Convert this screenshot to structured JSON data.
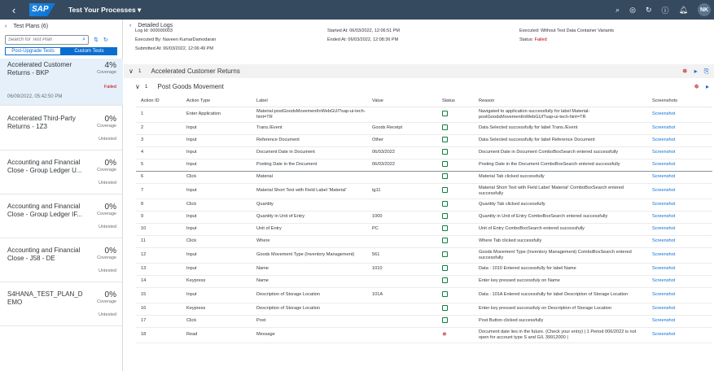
{
  "shell": {
    "app_title": "Test Your Processes ▾",
    "user_initials": "NK",
    "logo_text": "SAP"
  },
  "left": {
    "header": "Test Plans (6)",
    "search_placeholder": "Search for Test Plan",
    "seg_post_upgrade": "Post-Upgrade Tests",
    "seg_custom": "Custom Tests",
    "plans": [
      {
        "name": "Accelerated Customer Returns - BKP",
        "pct": "4%",
        "coverage": "Coverage",
        "status": "Failed",
        "date": "06/09/2022, 05:42:50 PM"
      },
      {
        "name": "Accelerated Third-Party Returns - 1Z3",
        "pct": "0%",
        "coverage": "Coverage",
        "status": "Untested"
      },
      {
        "name": "Accounting and Financial Close - Group Ledger U...",
        "pct": "0%",
        "coverage": "Coverage",
        "status": "Untested"
      },
      {
        "name": "Accounting and Financial Close - Group Ledger IF...",
        "pct": "0%",
        "coverage": "Coverage",
        "status": "Untested"
      },
      {
        "name": "Accounting and Financial Close - J58 - DE",
        "pct": "0%",
        "coverage": "Coverage",
        "status": "Untested"
      },
      {
        "name": "S4HANA_TEST_PLAN_DEMO",
        "pct": "0%",
        "coverage": "Coverage",
        "status": "Untested"
      }
    ]
  },
  "detail": {
    "header": "Detailed Logs",
    "log_id": "Log Id: 000000003",
    "executed_by": "Executed By: Naveen KumarDamodaran",
    "submitted_at": "Submitted At: 06/03/2022, 12:06:49 PM",
    "started_at": "Started At: 06/03/2022, 12:06:51 PM",
    "ended_at": "Ended At: 06/03/2022, 12:08:36 PM",
    "executed_mode": "Executed: Without Test Data Container Variants",
    "status_label": "Status:",
    "status_value": "Failed",
    "group1_index": "1",
    "group1_title": "Accelerated Customer Returns",
    "group2_index": "1",
    "group2_title": "Post Goods Movement"
  },
  "table": {
    "columns": [
      "Action ID",
      "Action Type",
      "Label",
      "Value",
      "Status",
      "Reason",
      "Screenshots"
    ],
    "rows": [
      {
        "id": "1",
        "type": "Enter Application",
        "label": "Material-postGoodsMovementInWebGUI?sap-ui-tech-hint=TR",
        "value": "",
        "status": "ok",
        "reason": "Navigated to application successfully for label Material-postGoodsMovementInWebGUI?sap-ui-tech-hint=TR",
        "shot": "Screenshot"
      },
      {
        "id": "2",
        "type": "Input",
        "label": "Trans./Event",
        "value": "Goods Receipt",
        "status": "ok",
        "reason": "Data Selected successfully for label Trans./Event",
        "shot": "Screenshot"
      },
      {
        "id": "3",
        "type": "Input",
        "label": "Reference Document",
        "value": "Other",
        "status": "ok",
        "reason": "Data Selected successfully for label Reference Document",
        "shot": "Screenshot"
      },
      {
        "id": "4",
        "type": "Input",
        "label": "Document Date in Document",
        "value": "06/03/2022",
        "status": "ok",
        "reason": "Document Date in Document ComboBoxSearch entered successfully",
        "shot": "Screenshot"
      },
      {
        "id": "5",
        "type": "Input",
        "label": "Posting Date in the Document",
        "value": "06/03/2022",
        "status": "ok",
        "reason": "Posting Date in the Document ComboBoxSearch entered successfully",
        "shot": "Screenshot"
      },
      {
        "id": "6",
        "type": "Click",
        "label": "Material",
        "value": "",
        "status": "ok",
        "reason": "Material Tab clicked successfully",
        "shot": "Screenshot"
      },
      {
        "id": "7",
        "type": "Input",
        "label": "Material Short Text with Field Label 'Material'",
        "value": "tg11",
        "status": "ok",
        "reason": "Material Short Text with Field Label 'Material' ComboBoxSearch entered successfully",
        "shot": "Screenshot"
      },
      {
        "id": "8",
        "type": "Click",
        "label": "Quantity",
        "value": "",
        "status": "ok",
        "reason": "Quantity Tab clicked successfully",
        "shot": "Screenshot"
      },
      {
        "id": "9",
        "type": "Input",
        "label": "Quantity in Unit of Entry",
        "value": "1000",
        "status": "ok",
        "reason": "Quantity in Unit of Entry ComboBoxSearch entered successfully",
        "shot": "Screenshot"
      },
      {
        "id": "10",
        "type": "Input",
        "label": "Unit of Entry",
        "value": "PC",
        "status": "ok",
        "reason": "Unit of Entry ComboBoxSearch entered successfully",
        "shot": "Screenshot"
      },
      {
        "id": "11",
        "type": "Click",
        "label": "Where",
        "value": "",
        "status": "ok",
        "reason": "Where Tab clicked successfully",
        "shot": "Screenshot"
      },
      {
        "id": "12",
        "type": "Input",
        "label": "Goods Movement Type (Inventory Management)",
        "value": "561",
        "status": "ok",
        "reason": "Goods Movement Type (Inventory Management) ComboBoxSearch entered successfully",
        "shot": "Screenshot"
      },
      {
        "id": "13",
        "type": "Input",
        "label": "Name",
        "value": "1010",
        "status": "ok",
        "reason": "Data : 1010 Entered successfully for label Name",
        "shot": "Screenshot"
      },
      {
        "id": "14",
        "type": "Keypress",
        "label": "Name",
        "value": "",
        "status": "ok",
        "reason": "Enter key pressed successfuly on Name",
        "shot": "Screenshot"
      },
      {
        "id": "15",
        "type": "Input",
        "label": "Description of Storage Location",
        "value": "101A",
        "status": "ok",
        "reason": "Data : 101A Entered successfully for label Description of Storage Location",
        "shot": "Screenshot"
      },
      {
        "id": "16",
        "type": "Keypress",
        "label": "Description of Storage Location",
        "value": "",
        "status": "ok",
        "reason": "Enter key pressed successfuly on Description of Storage Location",
        "shot": "Screenshot"
      },
      {
        "id": "17",
        "type": "Click",
        "label": "Post",
        "value": "",
        "status": "ok",
        "reason": "Post Button clicked successfully",
        "shot": "Screenshot"
      },
      {
        "id": "18",
        "type": "Read",
        "label": "Message",
        "value": "",
        "status": "error",
        "reason": "Document date lies in the future. (Check your entry) | 1 Period 006/2022 is not open for account type S and G/L 39912000 |",
        "shot": "Screenshot"
      }
    ]
  }
}
